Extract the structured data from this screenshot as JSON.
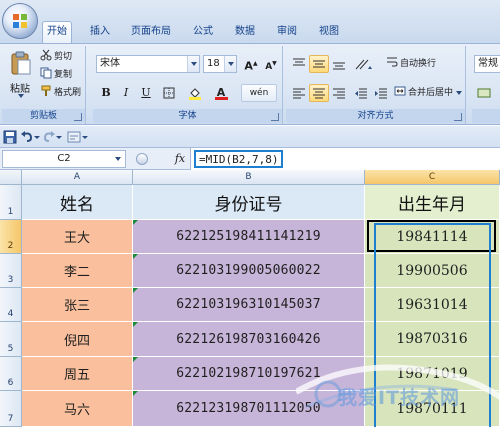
{
  "ribbon": {
    "tabs": [
      "开始",
      "插入",
      "页面布局",
      "公式",
      "数据",
      "审阅",
      "视图"
    ],
    "clipboard": {
      "paste": "粘贴",
      "cut": "剪切",
      "copy": "复制",
      "format_painter": "格式刷",
      "label": "剪贴板"
    },
    "font": {
      "name": "宋体",
      "size": "18",
      "grow": "A",
      "shrink": "A",
      "bold": "B",
      "italic": "I",
      "underline": "U",
      "phonetic": "wén",
      "label": "字体"
    },
    "alignment": {
      "wrap_text": "自动换行",
      "merge_center": "合并后居中",
      "label": "对齐方式"
    },
    "number": {
      "format": "常规"
    }
  },
  "formula_bar": {
    "name_box": "C2",
    "fx": "fx",
    "formula": "=MID(B2,7,8)"
  },
  "sheet": {
    "columns": [
      "A",
      "B",
      "C"
    ],
    "rows": [
      "1",
      "2",
      "3",
      "4",
      "5",
      "6",
      "7"
    ],
    "headers": [
      "姓名",
      "身份证号",
      "出生年月"
    ],
    "data": [
      {
        "name": "王大",
        "id": "622125198411141219",
        "birth": "19841114"
      },
      {
        "name": "李二",
        "id": "622103199005060022",
        "birth": "19900506"
      },
      {
        "name": "张三",
        "id": "622103196310145037",
        "birth": "19631014"
      },
      {
        "name": "倪四",
        "id": "622126198703160426",
        "birth": "19870316"
      },
      {
        "name": "周五",
        "id": "622102198710197621",
        "birth": "19871019"
      },
      {
        "name": "马六",
        "id": "622123198701112050",
        "birth": "19870111"
      }
    ]
  },
  "watermark": {
    "text": "我爱IT技术网"
  }
}
